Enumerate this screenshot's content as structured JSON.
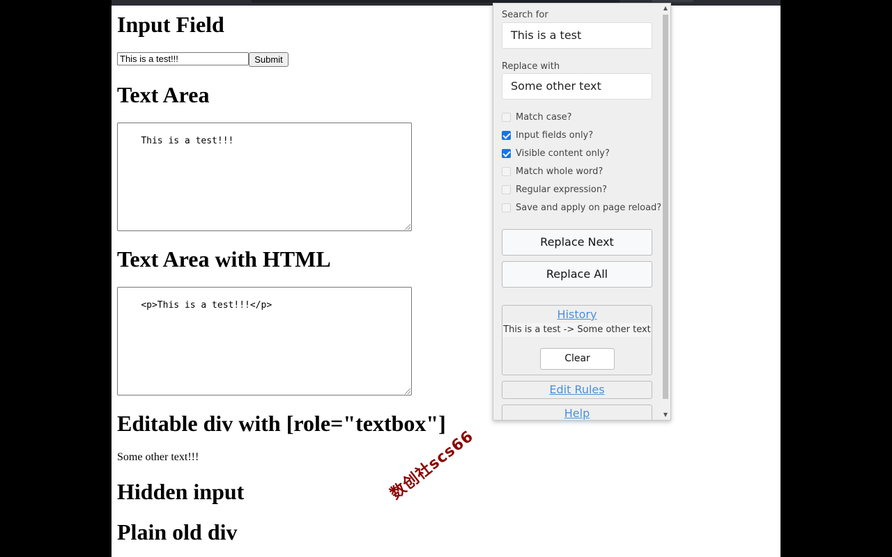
{
  "page": {
    "headings": [
      "Input Field",
      "Text Area",
      "Text Area with HTML",
      "Editable div with [role=\"textbox\"]",
      "Hidden input",
      "Plain old div"
    ],
    "input_value": "This is a test!!!",
    "submit_label": "Submit",
    "textarea1_value": "This is a test!!!",
    "textarea2_value": "<p>This is a test!!!</p>",
    "editable_div_text": "Some other text!!!",
    "watermark_text": "数创社scs66"
  },
  "popup": {
    "search_label": "Search for",
    "search_value": "This is a test",
    "replace_label": "Replace with",
    "replace_value": "Some other text",
    "options": [
      {
        "label": "Match case?",
        "checked": false
      },
      {
        "label": "Input fields only?",
        "checked": true
      },
      {
        "label": "Visible content only?",
        "checked": true
      },
      {
        "label": "Match whole word?",
        "checked": false
      },
      {
        "label": "Regular expression?",
        "checked": false
      },
      {
        "label": "Save and apply on page reload?",
        "checked": false
      }
    ],
    "replace_next_label": "Replace Next",
    "replace_all_label": "Replace All",
    "history_title": "History",
    "history_entry": "This is a test -> Some other text",
    "clear_label": "Clear",
    "edit_rules_label": "Edit Rules",
    "help_label": "Help"
  },
  "colors": {
    "link": "#4a90d9",
    "checkbox_checked": "#1a73e8",
    "watermark": "#8b0000"
  }
}
